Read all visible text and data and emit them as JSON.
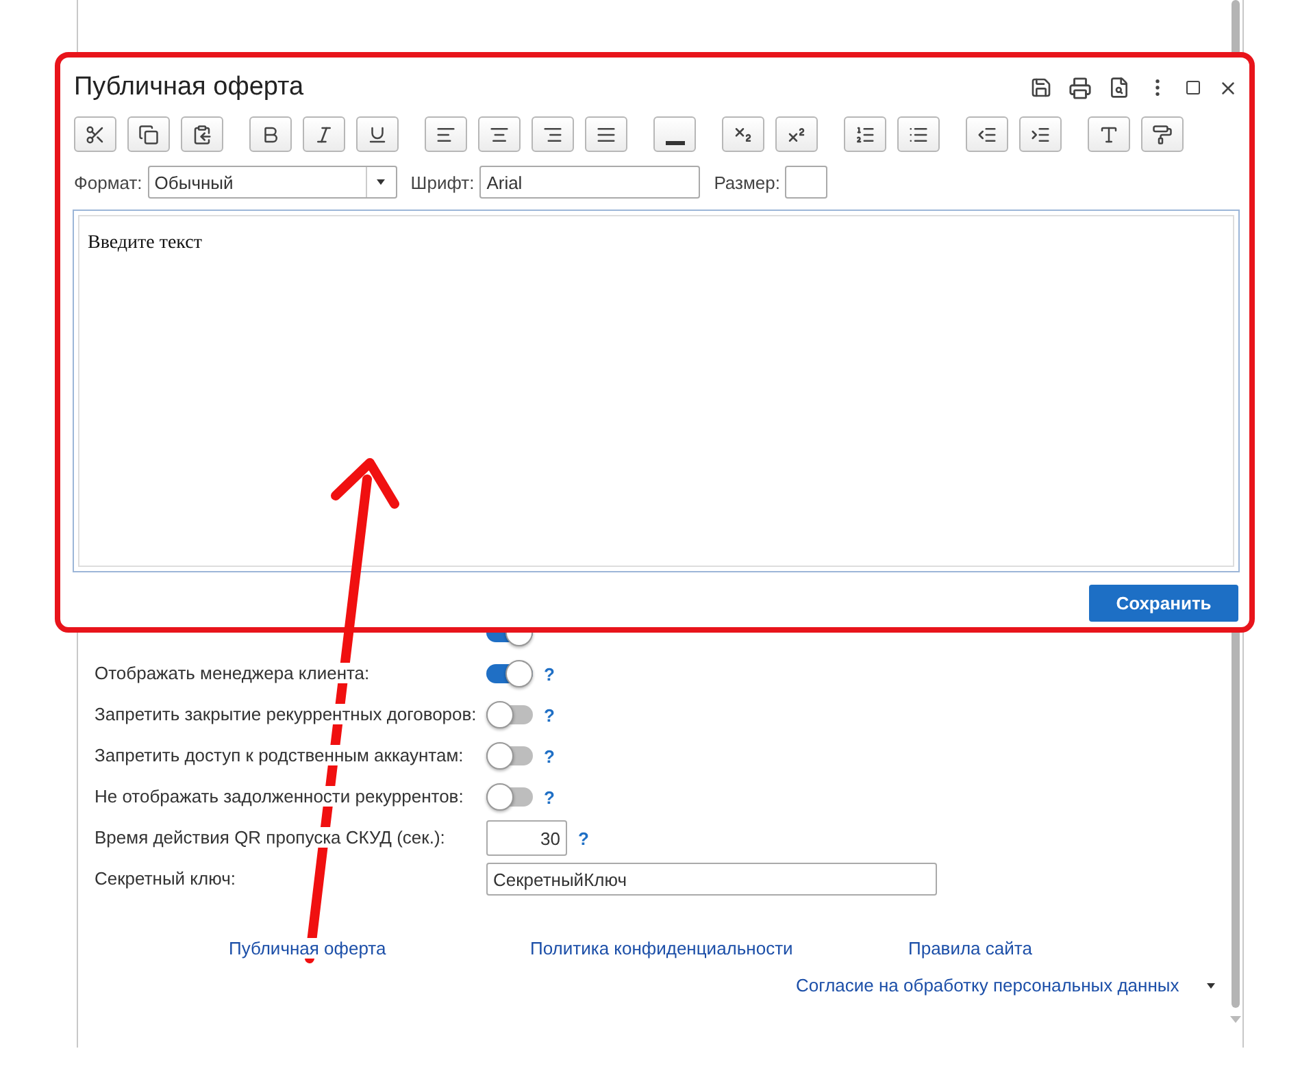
{
  "dialog": {
    "title": "Публичная оферта",
    "toolbar": [
      [
        {
          "kind": "cut"
        },
        {
          "kind": "copy"
        },
        {
          "kind": "paste"
        }
      ],
      [
        {
          "kind": "bold"
        },
        {
          "kind": "italic"
        },
        {
          "kind": "underline"
        }
      ],
      [
        {
          "kind": "align-left"
        },
        {
          "kind": "align-center"
        },
        {
          "kind": "align-right"
        },
        {
          "kind": "justify"
        }
      ],
      [
        {
          "kind": "line"
        }
      ],
      [
        {
          "kind": "subscript"
        },
        {
          "kind": "superscript"
        }
      ],
      [
        {
          "kind": "numbered-list"
        },
        {
          "kind": "bullet-list"
        }
      ],
      [
        {
          "kind": "outdent"
        },
        {
          "kind": "indent"
        }
      ],
      [
        {
          "kind": "font-color"
        },
        {
          "kind": "format-paint"
        }
      ]
    ],
    "format": {
      "label": "Формат:",
      "value": "Обычный"
    },
    "font": {
      "label": "Шрифт:",
      "value": "Arial"
    },
    "size": {
      "label": "Размер:"
    },
    "editor_text": "Введите текст",
    "save_button": "Сохранить"
  },
  "settings": [
    {
      "kind": "toggle",
      "on": true
    },
    {
      "kind": "toggle",
      "label": "Отображать менеджера клиента:",
      "on": true,
      "help": "?"
    },
    {
      "kind": "toggle",
      "label": "Запретить закрытие рекуррентных договоров:",
      "on": false,
      "help": "?"
    },
    {
      "kind": "toggle",
      "label": "Запретить доступ к родственным аккаунтам:",
      "on": false,
      "help": "?"
    },
    {
      "kind": "toggle",
      "label": "Не отображать задолженности рекуррентов:",
      "on": false,
      "help": "?"
    },
    {
      "kind": "number",
      "label": "Время действия QR пропуска СКУД (сек.):",
      "value": "30",
      "help": "?"
    },
    {
      "kind": "text",
      "label": "Секретный ключ:",
      "value": "СекретныйКлюч"
    }
  ],
  "links": [
    "Публичная оферта",
    "Политика конфиденциальности",
    "Правила сайта"
  ],
  "consent_link": "Согласие на обработку персональных данных"
}
